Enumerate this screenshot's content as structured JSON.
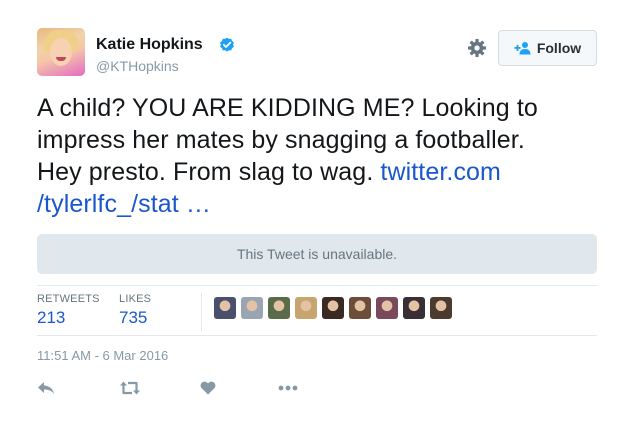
{
  "user": {
    "name": "Katie Hopkins",
    "handle": "@KTHopkins",
    "verified": true
  },
  "follow_button": {
    "label": "Follow",
    "icon": "add-user-icon"
  },
  "settings_icon": "gear-icon",
  "tweet": {
    "lines": [
      "A child? YOU ARE KIDDING ME? Looking to",
      "impress her mates by snagging a footballer.",
      "Hey presto. From slag to wag."
    ],
    "link_part1": "twitter.com",
    "link_part2": "/tylerlfc_/stat …"
  },
  "quoted_tweet": {
    "text": "This Tweet is unavailable."
  },
  "stats": {
    "retweets_label": "RETWEETS",
    "retweets_value": "213",
    "likes_label": "LIKES",
    "likes_value": "735"
  },
  "liker_avatars": [
    "#4a4f6b",
    "#9aa5b4",
    "#5a6b4a",
    "#c7a56e",
    "#3b2a24",
    "#6b4d3a",
    "#7a4a5c",
    "#3a2f36",
    "#4b3a2e"
  ],
  "timestamp": "11:51 AM - 6 Mar 2016",
  "actions": [
    "reply-icon",
    "retweet-icon",
    "like-icon",
    "more-icon"
  ],
  "colors": {
    "link": "#1b57cc",
    "muted": "#8899a6",
    "verified": "#1da1f2"
  }
}
